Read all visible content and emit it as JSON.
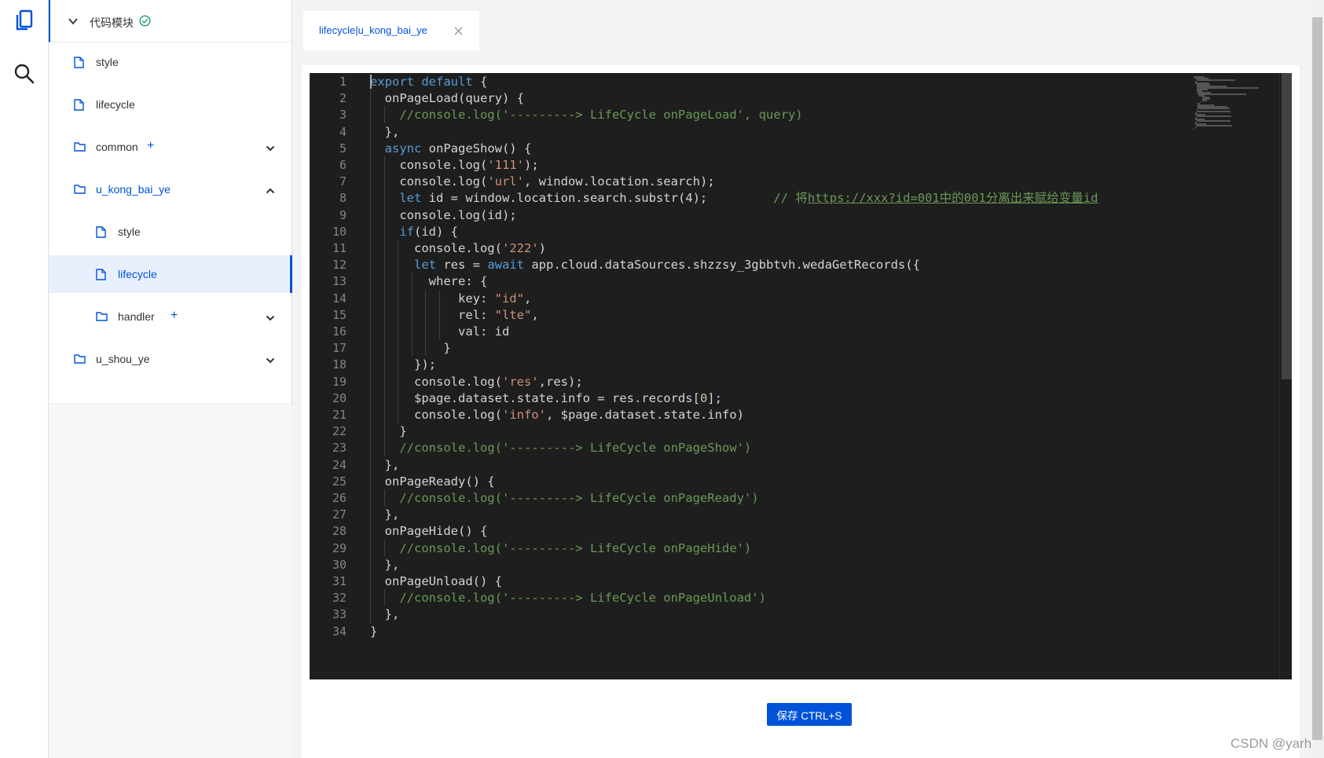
{
  "activity": {
    "items": [
      {
        "icon": "code-file-icon"
      },
      {
        "icon": "search-icon"
      }
    ]
  },
  "tree": {
    "header_title": "代码模块",
    "nodes": [
      {
        "label": "style",
        "type": "file",
        "depth": 1
      },
      {
        "label": "lifecycle",
        "type": "file",
        "depth": 1
      },
      {
        "label": "common",
        "type": "folder",
        "depth": 1,
        "plus": "+",
        "expanded": false
      },
      {
        "label": "u_kong_bai_ye",
        "type": "folder",
        "depth": 1,
        "expanded": true,
        "color": "#0052d9"
      },
      {
        "label": "style",
        "type": "file",
        "depth": 2
      },
      {
        "label": "lifecycle",
        "type": "file",
        "depth": 2,
        "active": true
      },
      {
        "label": "handler",
        "type": "folder",
        "depth": 2,
        "plus": "+",
        "expanded": false
      },
      {
        "label": "u_shou_ye",
        "type": "folder",
        "depth": 1,
        "expanded": false
      }
    ]
  },
  "editor": {
    "tab_label": "lifecycle|u_kong_bai_ye",
    "tab_close": "X",
    "line_numbers": [
      "1",
      "2",
      "3",
      "4",
      "5",
      "6",
      "7",
      "8",
      "9",
      "10",
      "11",
      "12",
      "13",
      "14",
      "15",
      "16",
      "17",
      "18",
      "19",
      "20",
      "21",
      "22",
      "23",
      "24",
      "25",
      "26",
      "27",
      "28",
      "29",
      "30",
      "31",
      "32",
      "33",
      "34"
    ],
    "lines": [
      [
        [
          "kw",
          "export default"
        ],
        [
          "t",
          " {"
        ]
      ],
      [
        [
          "t",
          "  onPageLoad(query) {"
        ]
      ],
      [
        [
          "cm",
          "    //console.log('---------> LifeCycle onPageLoad', query)"
        ]
      ],
      [
        [
          "t",
          "  },"
        ]
      ],
      [
        [
          "kw",
          "  async"
        ],
        [
          "t",
          " onPageShow() {"
        ]
      ],
      [
        [
          "t",
          "    console.log("
        ],
        [
          "str",
          "'111'"
        ],
        [
          "t",
          ");"
        ]
      ],
      [
        [
          "t",
          "    console.log("
        ],
        [
          "str",
          "'url'"
        ],
        [
          "t",
          ", window.location.search);"
        ]
      ],
      [
        [
          "kw",
          "    let"
        ],
        [
          "t",
          " id = window.location.search.substr(4);"
        ],
        [
          "cm",
          "         // 将"
        ],
        [
          "cmlink",
          "https://xxx?id=001中的001分离出来赋给变量id"
        ]
      ],
      [
        [
          "t",
          "    console.log(id);"
        ]
      ],
      [
        [
          "kw",
          "    if"
        ],
        [
          "t",
          "(id) {"
        ]
      ],
      [
        [
          "t",
          "      console.log("
        ],
        [
          "str",
          "'222'"
        ],
        [
          "t",
          ")"
        ]
      ],
      [
        [
          "kw",
          "      let"
        ],
        [
          "t",
          " res = "
        ],
        [
          "kw",
          "await"
        ],
        [
          "t",
          " app.cloud.dataSources.shzzsy_3gbbtvh.wedaGetRecords({"
        ]
      ],
      [
        [
          "t",
          "        where: {"
        ]
      ],
      [
        [
          "t",
          "            key: "
        ],
        [
          "str",
          "\"id\""
        ],
        [
          "t",
          ","
        ]
      ],
      [
        [
          "t",
          "            rel: "
        ],
        [
          "str",
          "\"lte\""
        ],
        [
          "t",
          ","
        ]
      ],
      [
        [
          "t",
          "            val: id"
        ]
      ],
      [
        [
          "t",
          "          }"
        ]
      ],
      [
        [
          "t",
          "      });"
        ]
      ],
      [
        [
          "t",
          "      console.log("
        ],
        [
          "str",
          "'res'"
        ],
        [
          "t",
          ",res);"
        ]
      ],
      [
        [
          "t",
          "      $page.dataset.state.info = res.records["
        ],
        [
          "num",
          "0"
        ],
        [
          "t",
          "];"
        ]
      ],
      [
        [
          "t",
          "      console.log("
        ],
        [
          "str",
          "'info'"
        ],
        [
          "t",
          ", $page.dataset.state.info)"
        ]
      ],
      [
        [
          "t",
          "    }"
        ]
      ],
      [
        [
          "cm",
          "    //console.log('---------> LifeCycle onPageShow')"
        ]
      ],
      [
        [
          "t",
          "  },"
        ]
      ],
      [
        [
          "t",
          "  onPageReady() {"
        ]
      ],
      [
        [
          "cm",
          "    //console.log('---------> LifeCycle onPageReady')"
        ]
      ],
      [
        [
          "t",
          "  },"
        ]
      ],
      [
        [
          "t",
          "  onPageHide() {"
        ]
      ],
      [
        [
          "cm",
          "    //console.log('---------> LifeCycle onPageHide')"
        ]
      ],
      [
        [
          "t",
          "  },"
        ]
      ],
      [
        [
          "t",
          "  onPageUnload() {"
        ]
      ],
      [
        [
          "cm",
          "    //console.log('---------> LifeCycle onPageUnload')"
        ]
      ],
      [
        [
          "t",
          "  },"
        ]
      ],
      [
        [
          "t",
          "}"
        ]
      ]
    ],
    "save_label": "保存 CTRL+S"
  },
  "watermark": "CSDN @yarh",
  "colors": {
    "accent": "#0052d9",
    "editor_bg": "#1e1e1e",
    "keyword": "#569cd6",
    "string": "#ce9178",
    "comment": "#6a9955",
    "number": "#b5cea8",
    "status_ok": "#2ba471"
  }
}
